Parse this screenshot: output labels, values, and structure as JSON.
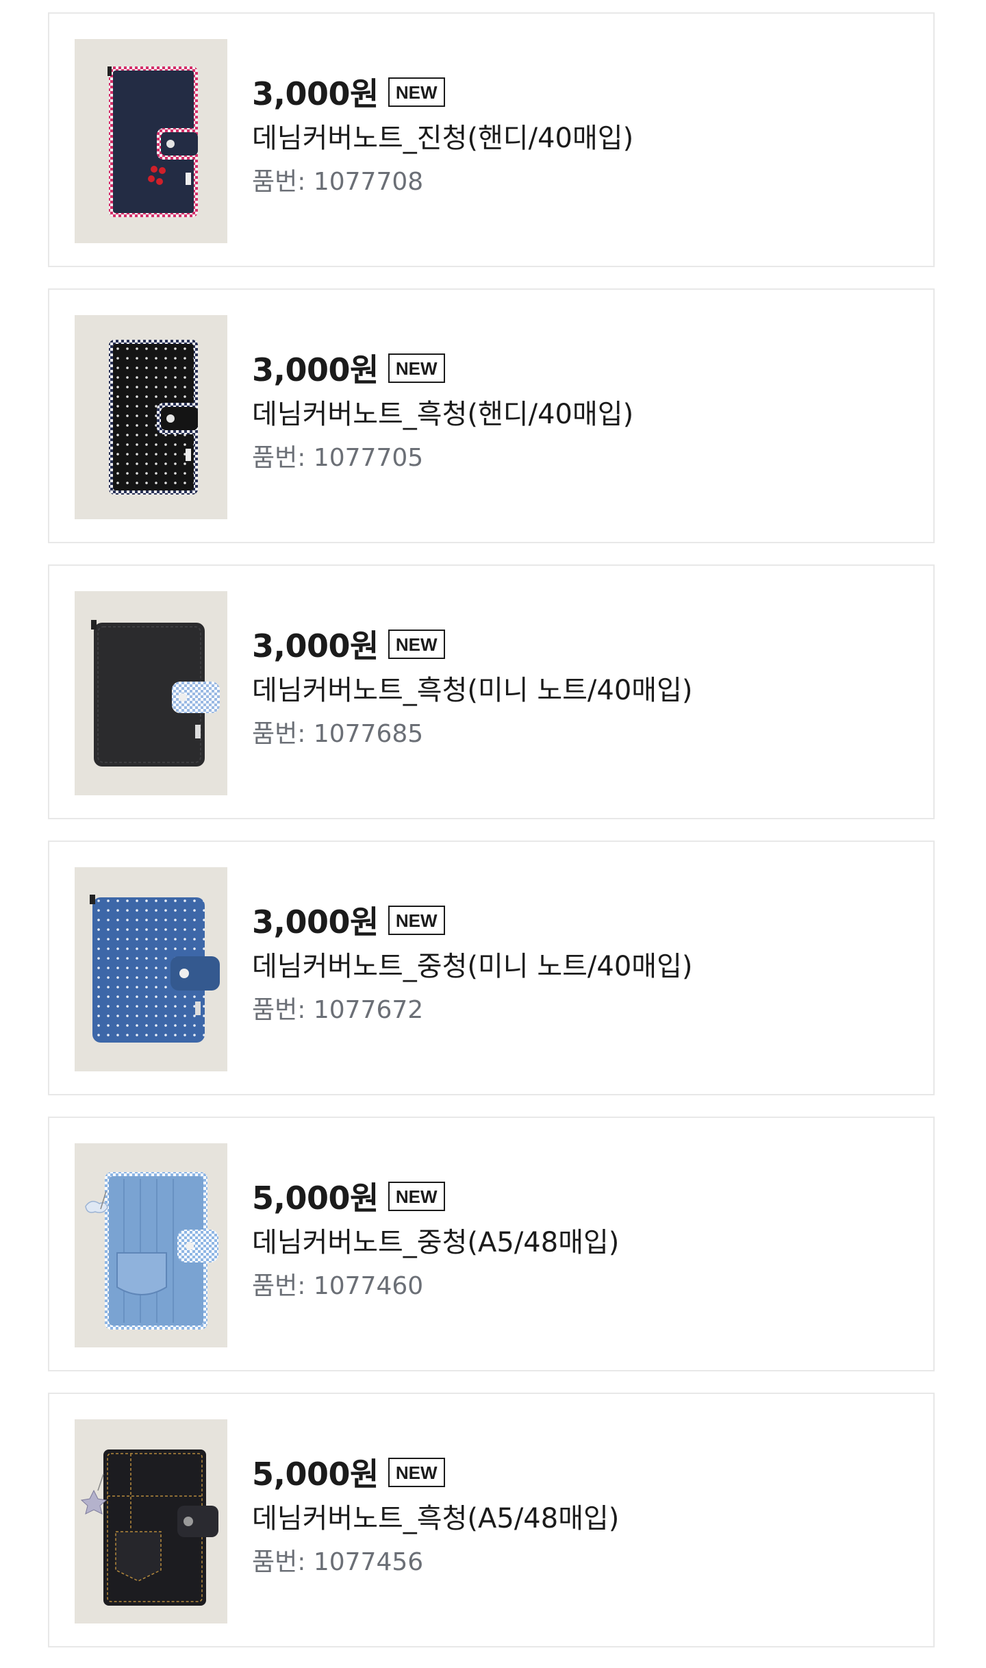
{
  "products": [
    {
      "price": "3,000원",
      "badge": "NEW",
      "name": "데님커버노트_진청(핸디/40매입)",
      "code_label": "품번:",
      "code": "1077708"
    },
    {
      "price": "3,000원",
      "badge": "NEW",
      "name": "데님커버노트_흑청(핸디/40매입)",
      "code_label": "품번:",
      "code": "1077705"
    },
    {
      "price": "3,000원",
      "badge": "NEW",
      "name": "데님커버노트_흑청(미니 노트/40매입)",
      "code_label": "품번:",
      "code": "1077685"
    },
    {
      "price": "3,000원",
      "badge": "NEW",
      "name": "데님커버노트_중청(미니 노트/40매입)",
      "code_label": "품번:",
      "code": "1077672"
    },
    {
      "price": "5,000원",
      "badge": "NEW",
      "name": "데님커버노트_중청(A5/48매입)",
      "code_label": "품번:",
      "code": "1077460"
    },
    {
      "price": "5,000원",
      "badge": "NEW",
      "name": "데님커버노트_흑청(A5/48매입)",
      "code_label": "품번:",
      "code": "1077456"
    }
  ],
  "colors": {
    "text": "#1b1b1b",
    "muted": "#6b6f76",
    "border": "#e8e8e8",
    "thumb_bg": "#e6e3dc"
  }
}
